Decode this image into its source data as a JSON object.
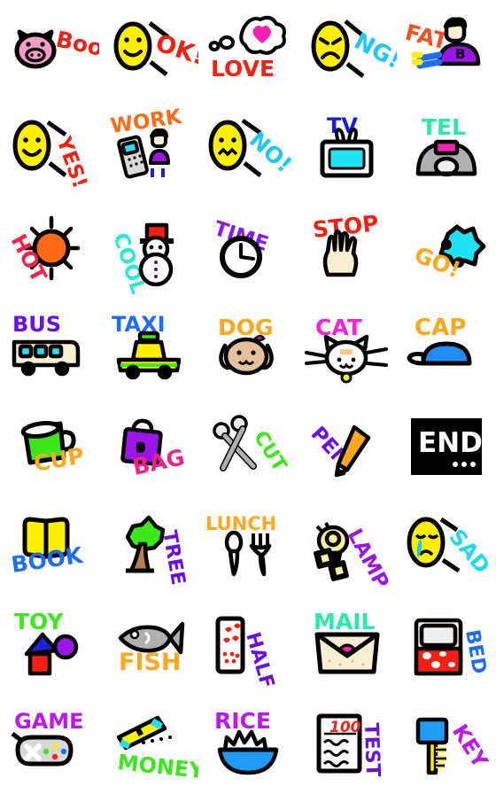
{
  "app": {
    "type": "sticker-pack-grid",
    "background_color": "#ffffff",
    "columns": 5,
    "rows": 8,
    "total_stickers": 40,
    "style": "hand-drawn doodle emoji with handwritten word labels"
  },
  "palette": {
    "red": "#f51f12",
    "orange": "#ff7518",
    "amber": "#ffa81e",
    "yellow": "#fff000",
    "green": "#3ce81b",
    "lime": "#7bf018",
    "cyan": "#1fe3f5",
    "turquoise": "#2ae8b0",
    "blue": "#1f6df5",
    "royal": "#1414e6",
    "purple": "#9b15e8",
    "violet": "#6a10e0",
    "magenta": "#f51fb0",
    "pink": "#f59ccb",
    "black": "#000000",
    "white": "#ffffff",
    "gray": "#b0b0b0",
    "cream": "#f8eed2",
    "tan": "#e8c19a",
    "brown": "#b5814f"
  },
  "stickers": [
    {
      "id": 1,
      "row": 1,
      "col": 1,
      "name": "boo-pig",
      "label": "Boo",
      "label_color": "#f51f12",
      "icon": "pig-face-icon",
      "icon_colors": [
        "#f59ccb",
        "#000000"
      ]
    },
    {
      "id": 2,
      "row": 1,
      "col": 2,
      "name": "ok-smile",
      "label": "OK!",
      "label_color": "#f51f12",
      "icon": "smiling-face-icon",
      "icon_colors": [
        "#fff000",
        "#000000"
      ]
    },
    {
      "id": 3,
      "row": 1,
      "col": 3,
      "name": "love-heart",
      "label": "LOVE",
      "label_color": "#f51f12",
      "icon": "heart-thought-bubble-icon",
      "icon_colors": [
        "#ffffff",
        "#f51fb0"
      ]
    },
    {
      "id": 4,
      "row": 1,
      "col": 4,
      "name": "angry-face",
      "label": "NG!",
      "label_color": "#1fc8f5",
      "icon": "frowning-face-icon",
      "icon_colors": [
        "#fff000",
        "#000000"
      ]
    },
    {
      "id": 5,
      "row": 1,
      "col": 5,
      "name": "fat-person",
      "label": "FAT",
      "label_color": "#f5501f",
      "icon": "seated-person-icon",
      "icon_colors": [
        "#9b15e8",
        "#1f6df5"
      ]
    },
    {
      "id": 6,
      "row": 2,
      "col": 1,
      "name": "yes-smile",
      "label": "YES!",
      "label_color": "#f51f12",
      "icon": "smiling-face-icon",
      "icon_colors": [
        "#fff000",
        "#000000"
      ]
    },
    {
      "id": 7,
      "row": 2,
      "col": 2,
      "name": "work-phone",
      "label": "WORK",
      "label_color": "#ff6a14",
      "icon": "person-with-calculator-icon",
      "icon_colors": [
        "#9b15e8",
        "#d8d8d8"
      ]
    },
    {
      "id": 8,
      "row": 2,
      "col": 3,
      "name": "no-face",
      "label": "NO!",
      "label_color": "#1fc8f5",
      "icon": "worried-face-icon",
      "icon_colors": [
        "#fff000",
        "#000000"
      ]
    },
    {
      "id": 9,
      "row": 2,
      "col": 4,
      "name": "tv-set",
      "label": "TV",
      "label_color": "#1a1ae6",
      "icon": "television-icon",
      "icon_colors": [
        "#1fe3f5",
        "#ffffff"
      ]
    },
    {
      "id": 10,
      "row": 2,
      "col": 5,
      "name": "telephone",
      "label": "TEL",
      "label_color": "#2ae8b0",
      "icon": "rotary-phone-icon",
      "icon_colors": [
        "#b0b0b0",
        "#f51fb0"
      ]
    },
    {
      "id": 11,
      "row": 3,
      "col": 1,
      "name": "hot-sun",
      "label": "HOT",
      "label_color": "#f51f4a",
      "icon": "sun-icon",
      "icon_colors": [
        "#ff6a14",
        "#000000"
      ]
    },
    {
      "id": 12,
      "row": 3,
      "col": 2,
      "name": "cool-snowman",
      "label": "COOL",
      "label_color": "#2ae8d8",
      "icon": "snowman-icon",
      "icon_colors": [
        "#ffffff",
        "#f51f12"
      ]
    },
    {
      "id": 13,
      "row": 3,
      "col": 3,
      "name": "time-clock",
      "label": "TIME",
      "label_color": "#8a18f0",
      "icon": "clock-icon",
      "icon_colors": [
        "#ffffff",
        "#000000"
      ]
    },
    {
      "id": 14,
      "row": 3,
      "col": 4,
      "name": "stop-hand",
      "label": "STOP",
      "label_color": "#f51f12",
      "icon": "open-palm-hand-icon",
      "icon_colors": [
        "#f8eed2",
        "#000000"
      ]
    },
    {
      "id": 15,
      "row": 3,
      "col": 5,
      "name": "go-arrow",
      "label": "GO!",
      "label_color": "#ffa81e",
      "icon": "go-puzzle-arrow-icon",
      "icon_colors": [
        "#1fe3f5",
        "#000000"
      ]
    },
    {
      "id": 16,
      "row": 4,
      "col": 1,
      "name": "bus",
      "label": "BUS",
      "label_color": "#6a10e0",
      "icon": "bus-icon",
      "icon_colors": [
        "#f8eed2",
        "#1fe3f5"
      ]
    },
    {
      "id": 17,
      "row": 4,
      "col": 2,
      "name": "taxi",
      "label": "TAXI",
      "label_color": "#1f6df5",
      "icon": "taxi-icon",
      "icon_colors": [
        "#fff000",
        "#3ce81b"
      ]
    },
    {
      "id": 18,
      "row": 4,
      "col": 3,
      "name": "dog",
      "label": "DOG",
      "label_color": "#ffa81e",
      "icon": "dog-face-icon",
      "icon_colors": [
        "#e8c19a",
        "#f51fb0"
      ]
    },
    {
      "id": 19,
      "row": 4,
      "col": 4,
      "name": "cat",
      "label": "CAT",
      "label_color": "#f51fe0",
      "icon": "cat-face-icon",
      "icon_colors": [
        "#ffffff",
        "#ffa81e"
      ]
    },
    {
      "id": 20,
      "row": 4,
      "col": 5,
      "name": "cap",
      "label": "CAP",
      "label_color": "#ffa81e",
      "icon": "baseball-cap-icon",
      "icon_colors": [
        "#1f8df5",
        "#ffffff"
      ]
    },
    {
      "id": 21,
      "row": 5,
      "col": 1,
      "name": "cup",
      "label": "CUP",
      "label_color": "#ffa81e",
      "icon": "mug-icon",
      "icon_colors": [
        "#3ce81b",
        "#ffffff"
      ]
    },
    {
      "id": 22,
      "row": 5,
      "col": 2,
      "name": "bag",
      "label": "BAG",
      "label_color": "#f51f8a",
      "icon": "handbag-icon",
      "icon_colors": [
        "#9b15e8",
        "#000000"
      ]
    },
    {
      "id": 23,
      "row": 5,
      "col": 3,
      "name": "cut-scissors",
      "label": "CUT",
      "label_color": "#3ce81b",
      "icon": "scissors-icon",
      "icon_colors": [
        "#b0b0b0",
        "#ffffff"
      ]
    },
    {
      "id": 24,
      "row": 5,
      "col": 4,
      "name": "pen-pencil",
      "label": "PEN",
      "label_color": "#6a10e0",
      "icon": "pencil-icon",
      "icon_colors": [
        "#ffa81e",
        "#f8eed2"
      ]
    },
    {
      "id": 25,
      "row": 5,
      "col": 5,
      "name": "end-card",
      "label": "END",
      "label_color": "#ffffff",
      "icon": "end-black-card-icon",
      "icon_colors": [
        "#000000",
        "#ffffff"
      ]
    },
    {
      "id": 26,
      "row": 6,
      "col": 1,
      "name": "book",
      "label": "BOOK",
      "label_color": "#1f6df5",
      "icon": "open-book-icon",
      "icon_colors": [
        "#fff000",
        "#000000"
      ]
    },
    {
      "id": 27,
      "row": 6,
      "col": 2,
      "name": "tree",
      "label": "TREE",
      "label_color": "#6a10e0",
      "icon": "tree-icon",
      "icon_colors": [
        "#3ce81b",
        "#b5814f"
      ]
    },
    {
      "id": 28,
      "row": 6,
      "col": 3,
      "name": "lunch-cutlery",
      "label": "LUNCH",
      "label_color": "#ffa81e",
      "icon": "spoon-and-fork-icon",
      "icon_colors": [
        "#ffffff",
        "#000000"
      ]
    },
    {
      "id": 29,
      "row": 6,
      "col": 4,
      "name": "lamp",
      "label": "LAMP",
      "label_color": "#9b15e8",
      "icon": "light-bulb-icon",
      "icon_colors": [
        "#f8eea0",
        "#000000"
      ]
    },
    {
      "id": 30,
      "row": 6,
      "col": 5,
      "name": "sad-face",
      "label": "SAD",
      "label_color": "#1fd8f5",
      "icon": "crying-face-icon",
      "icon_colors": [
        "#fff000",
        "#1fc8f5"
      ]
    },
    {
      "id": 31,
      "row": 7,
      "col": 1,
      "name": "toy-blocks",
      "label": "TOY",
      "label_color": "#3ce81b",
      "icon": "toy-blocks-icon",
      "icon_colors": [
        "#1f1fe0",
        "#f51f12"
      ]
    },
    {
      "id": 32,
      "row": 7,
      "col": 2,
      "name": "fish",
      "label": "FISH",
      "label_color": "#ffa81e",
      "icon": "fish-icon",
      "icon_colors": [
        "#b0b0b0",
        "#ffffff"
      ]
    },
    {
      "id": 33,
      "row": 7,
      "col": 3,
      "name": "half-domino",
      "label": "HALF",
      "label_color": "#6a10e0",
      "icon": "domino-tile-icon",
      "icon_colors": [
        "#ffffff",
        "#f51f12"
      ]
    },
    {
      "id": 34,
      "row": 7,
      "col": 4,
      "name": "mail-envelope",
      "label": "MAIL",
      "label_color": "#2ae8b0",
      "icon": "envelope-heart-icon",
      "icon_colors": [
        "#f8eed2",
        "#f51fb0"
      ]
    },
    {
      "id": 35,
      "row": 7,
      "col": 5,
      "name": "bed",
      "label": "BED",
      "label_color": "#1f6df5",
      "icon": "bed-icon",
      "icon_colors": [
        "#f51f12",
        "#f8eed2"
      ]
    },
    {
      "id": 36,
      "row": 8,
      "col": 1,
      "name": "game-pad",
      "label": "GAME",
      "label_color": "#bb18f0",
      "icon": "gamepad-icon",
      "icon_colors": [
        "#d8d8d8",
        "#000000"
      ]
    },
    {
      "id": 37,
      "row": 8,
      "col": 2,
      "name": "money",
      "label": "MONEY",
      "label_color": "#3ce81b",
      "icon": "cash-bills-icon",
      "icon_colors": [
        "#fff000",
        "#1fe3f5"
      ]
    },
    {
      "id": 38,
      "row": 8,
      "col": 3,
      "name": "rice-bowl",
      "label": "RICE",
      "label_color": "#bb18f0",
      "icon": "rice-bowl-icon",
      "icon_colors": [
        "#1f9df5",
        "#ffffff"
      ]
    },
    {
      "id": 39,
      "row": 8,
      "col": 4,
      "name": "test-paper",
      "label": "TEST",
      "label_color": "#6a10e0",
      "icon": "test-paper-icon",
      "icon_colors": [
        "#ffffff",
        "#f51f12"
      ],
      "extra_text": "100"
    },
    {
      "id": 40,
      "row": 8,
      "col": 5,
      "name": "key",
      "label": "KEY",
      "label_color": "#bb18f0",
      "icon": "key-icon",
      "icon_colors": [
        "#1f9df5",
        "#fff000"
      ]
    }
  ]
}
